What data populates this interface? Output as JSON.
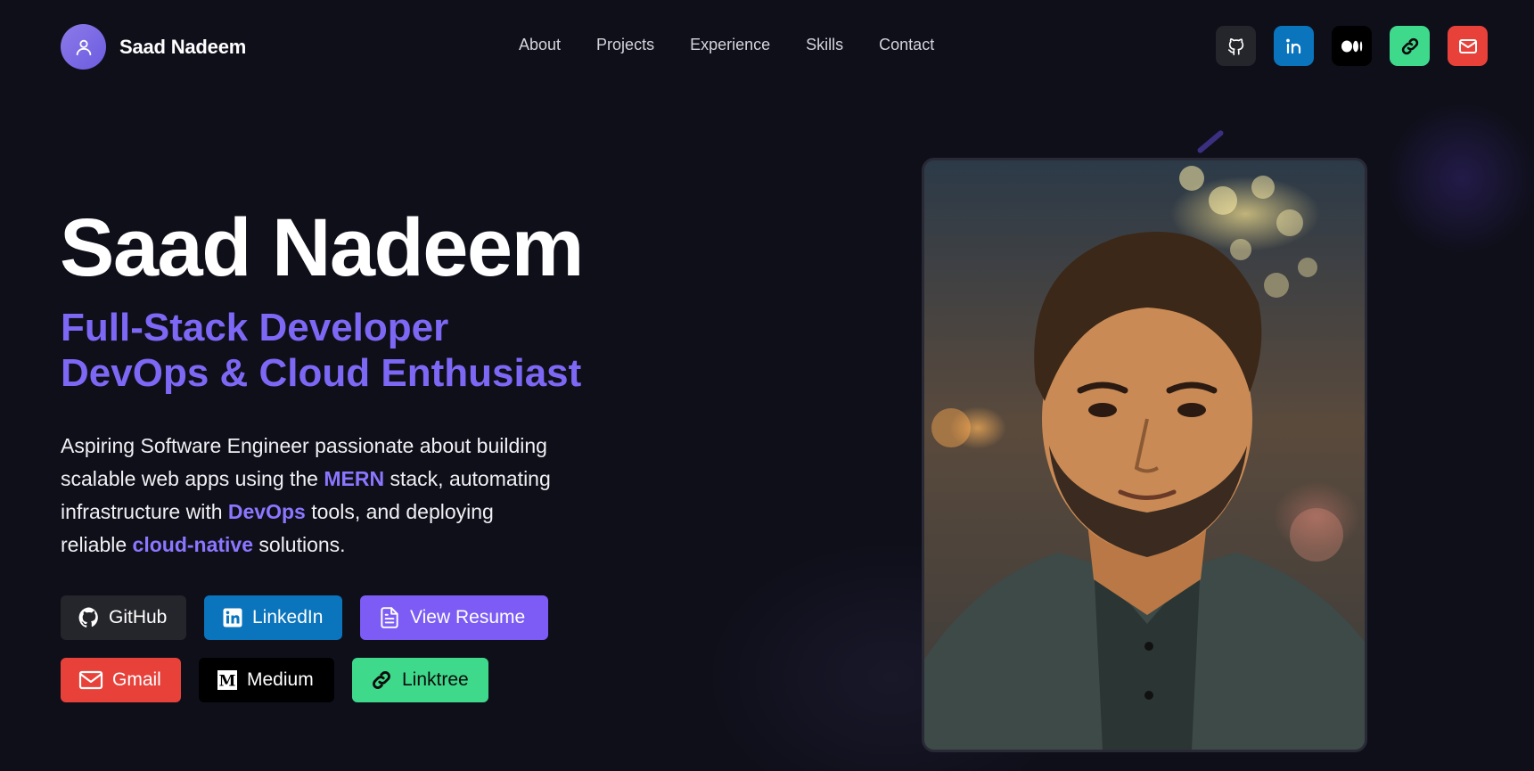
{
  "nav": {
    "brand_name": "Saad Nadeem",
    "links": [
      "About",
      "Projects",
      "Experience",
      "Skills",
      "Contact"
    ],
    "icons": [
      {
        "name": "github-icon",
        "color": "#25262b"
      },
      {
        "name": "linkedin-icon",
        "color": "#0a74bd"
      },
      {
        "name": "medium-icon",
        "color": "#000000"
      },
      {
        "name": "linktree-icon",
        "color": "#3fd98c"
      },
      {
        "name": "mail-icon",
        "color": "#e7413a"
      }
    ]
  },
  "hero": {
    "name": "Saad Nadeem",
    "role_1": "Full-Stack Developer",
    "role_2": "DevOps & Cloud Enthusiast",
    "desc": {
      "part_1": "Aspiring Software Engineer passionate about building scalable web apps using the ",
      "hl_1": "MERN",
      "part_2": " stack, automating infrastructure with ",
      "hl_2": "DevOps",
      "part_3": " tools, and deploying reliable ",
      "hl_3": "cloud-native",
      "part_4": " solutions."
    },
    "buttons": {
      "github": "GitHub",
      "linkedin": "LinkedIn",
      "resume": "View Resume",
      "gmail": "Gmail",
      "medium": "Medium",
      "linktree": "Linktree"
    }
  },
  "colors": {
    "background": "#0f0f1a",
    "accent": "#7c68f5",
    "highlight": "#8b76ff"
  }
}
